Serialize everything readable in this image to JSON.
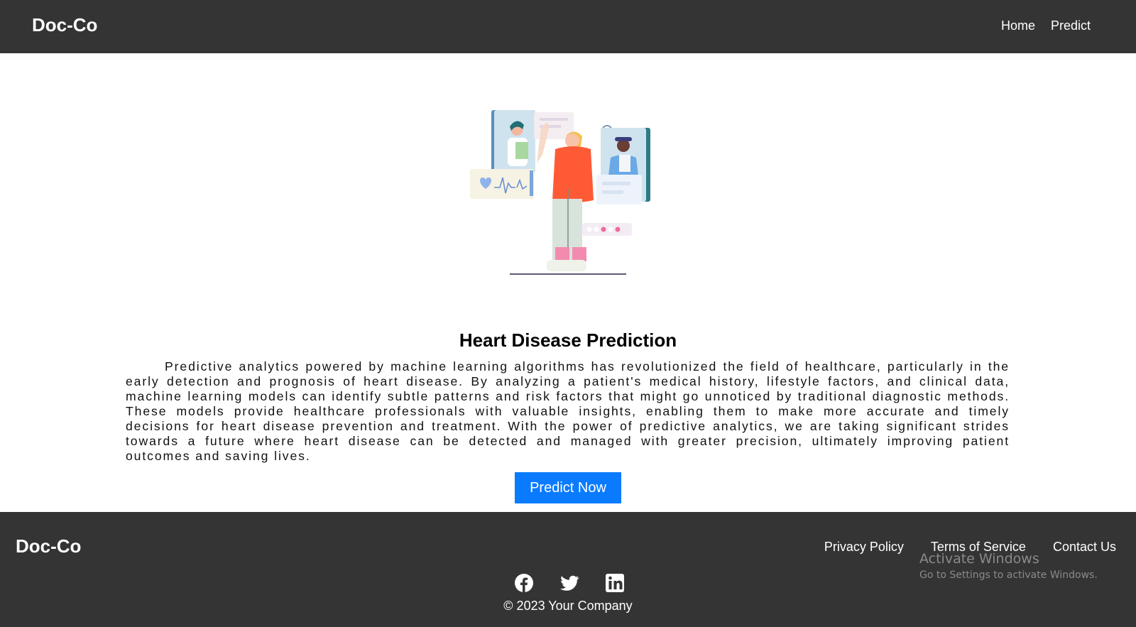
{
  "header": {
    "brand": "Doc-Co",
    "nav": [
      {
        "label": "Home"
      },
      {
        "label": "Predict"
      }
    ]
  },
  "main": {
    "illustration_icon": "doctor-patient-illustration",
    "title": "Heart Disease Prediction",
    "description": "Predictive analytics powered by machine learning algorithms has revolutionized the field of healthcare, particularly in the early detection and prognosis of heart disease. By analyzing a patient's medical history, lifestyle factors, and clinical data, machine learning models can identify subtle patterns and risk factors that might go unnoticed by traditional diagnostic methods. These models provide healthcare professionals with valuable insights, enabling them to make more accurate and timely decisions for heart disease prevention and treatment. With the power of predictive analytics, we are taking significant strides towards a future where heart disease can be detected and managed with greater precision, ultimately improving patient outcomes and saving lives.",
    "cta_label": "Predict Now"
  },
  "footer": {
    "brand": "Doc-Co",
    "links": [
      {
        "label": "Privacy Policy"
      },
      {
        "label": "Terms of Service"
      },
      {
        "label": "Contact Us"
      }
    ],
    "social_icons": [
      "facebook-icon",
      "twitter-icon",
      "linkedin-icon"
    ],
    "copyright": "© 2023 Your Company"
  },
  "watermark": {
    "line1": "Activate Windows",
    "line2": "Go to Settings to activate Windows."
  },
  "colors": {
    "header_bg": "#343434",
    "footer_bg": "#343434",
    "button_bg": "#0a7bff",
    "text_white": "#ffffff"
  }
}
